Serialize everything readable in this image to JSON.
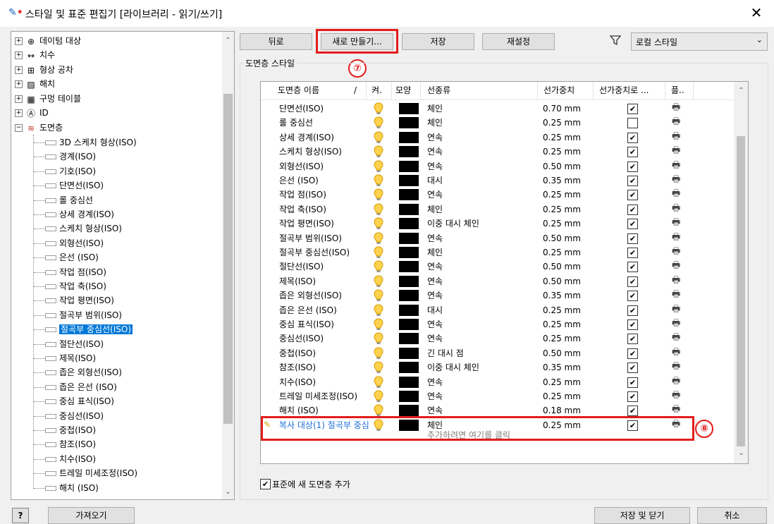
{
  "window": {
    "title": "스타일 및 표준 편집기 [라이브러리 - 읽기/쓰기]"
  },
  "tree": {
    "categories": [
      {
        "label": "데이텀 대상",
        "icon": "datum-target-icon"
      },
      {
        "label": "치수",
        "icon": "dimension-icon"
      },
      {
        "label": "형상 공차",
        "icon": "geometric-tolerance-icon"
      },
      {
        "label": "해치",
        "icon": "hatch-icon"
      },
      {
        "label": "구멍 테이블",
        "icon": "hole-table-icon"
      },
      {
        "label": "ID",
        "icon": "id-icon"
      },
      {
        "label": "도면층",
        "icon": "layer-icon"
      }
    ],
    "layers": [
      "3D 스케치 형상(ISO)",
      "경계(ISO)",
      "기호(ISO)",
      "단면선(ISO)",
      "롤 중심선",
      "상세 경계(ISO)",
      "스케치 형상(ISO)",
      "외형선(ISO)",
      "은선 (ISO)",
      "작업 점(ISO)",
      "작업 축(ISO)",
      "작업 평면(ISO)",
      "절곡부 범위(ISO)",
      "절곡부 중심선(ISO)",
      "절단선(ISO)",
      "제목(ISO)",
      "좁은 외형선(ISO)",
      "좁은 은선 (ISO)",
      "중심 표식(ISO)",
      "중심선(ISO)",
      "중첩(ISO)",
      "참조(ISO)",
      "치수(ISO)",
      "트레일 미세조정(ISO)",
      "해치 (ISO)"
    ],
    "selected": "절곡부 중심선(ISO)"
  },
  "toolbar": {
    "back": "뒤로",
    "new": "새로 만들기...",
    "save": "저장",
    "reset": "재설정",
    "filter_value": "로컬 스타일"
  },
  "annotations": {
    "seven": "⑦",
    "eight": "⑧"
  },
  "panel": {
    "label": "도면층 스타일"
  },
  "grid": {
    "headers": {
      "name": "도면층 이름",
      "slash": "/",
      "on": "켜.",
      "appearance": "모양",
      "linetype": "선종류",
      "lineweight": "선가중치",
      "scale_by_lw": "선가중치로 ...",
      "plot": "플.."
    },
    "rows": [
      {
        "name": "단면선(ISO)",
        "linetype": "체인",
        "lineweight": "0.70 mm",
        "scale": true
      },
      {
        "name": "롤 중심선",
        "linetype": "체인",
        "lineweight": "0.25 mm",
        "scale": false
      },
      {
        "name": "상세 경계(ISO)",
        "linetype": "연속",
        "lineweight": "0.25 mm",
        "scale": true
      },
      {
        "name": "스케치 형상(ISO)",
        "linetype": "연속",
        "lineweight": "0.25 mm",
        "scale": true
      },
      {
        "name": "외형선(ISO)",
        "linetype": "연속",
        "lineweight": "0.50 mm",
        "scale": true
      },
      {
        "name": "은선 (ISO)",
        "linetype": "대시",
        "lineweight": "0.35 mm",
        "scale": true
      },
      {
        "name": "작업 점(ISO)",
        "linetype": "연속",
        "lineweight": "0.25 mm",
        "scale": true
      },
      {
        "name": "작업 축(ISO)",
        "linetype": "체인",
        "lineweight": "0.25 mm",
        "scale": true
      },
      {
        "name": "작업 평면(ISO)",
        "linetype": "이중 대시 체인",
        "lineweight": "0.25 mm",
        "scale": true
      },
      {
        "name": "절곡부 범위(ISO)",
        "linetype": "연속",
        "lineweight": "0.50 mm",
        "scale": true
      },
      {
        "name": "절곡부 중심선(ISO)",
        "linetype": "체인",
        "lineweight": "0.25 mm",
        "scale": true
      },
      {
        "name": "절단선(ISO)",
        "linetype": "연속",
        "lineweight": "0.50 mm",
        "scale": true
      },
      {
        "name": "제목(ISO)",
        "linetype": "연속",
        "lineweight": "0.50 mm",
        "scale": true
      },
      {
        "name": "좁은 외형선(ISO)",
        "linetype": "연속",
        "lineweight": "0.35 mm",
        "scale": true
      },
      {
        "name": "좁은 은선 (ISO)",
        "linetype": "대시",
        "lineweight": "0.25 mm",
        "scale": true
      },
      {
        "name": "중심 표식(ISO)",
        "linetype": "연속",
        "lineweight": "0.25 mm",
        "scale": true
      },
      {
        "name": "중심선(ISO)",
        "linetype": "연속",
        "lineweight": "0.25 mm",
        "scale": true
      },
      {
        "name": "중첩(ISO)",
        "linetype": "긴 대시 점",
        "lineweight": "0.50 mm",
        "scale": true
      },
      {
        "name": "참조(ISO)",
        "linetype": "이중 대시 체인",
        "lineweight": "0.35 mm",
        "scale": true
      },
      {
        "name": "치수(ISO)",
        "linetype": "연속",
        "lineweight": "0.25 mm",
        "scale": true
      },
      {
        "name": "트레일 미세조정(ISO)",
        "linetype": "연속",
        "lineweight": "0.25 mm",
        "scale": true
      },
      {
        "name": "해치 (ISO)",
        "linetype": "연속",
        "lineweight": "0.18 mm",
        "scale": true
      }
    ],
    "new_row": {
      "name": "복사 대상(1) 절곡부 중심",
      "linetype": "체인",
      "lineweight": "0.25 mm",
      "scale": true
    },
    "add_hint": "추가하려면 여기를 클릭"
  },
  "footer": {
    "add_to_standard": "표준에 새 도면층 추가",
    "help": "?",
    "import": "가져오기",
    "save_close": "저장 및 닫기",
    "cancel": "취소"
  },
  "colors": {
    "selection": "#0078d7",
    "highlight": "#e31c1c",
    "new_row_text": "#1e6fd9",
    "bulb": "#f5b400"
  }
}
